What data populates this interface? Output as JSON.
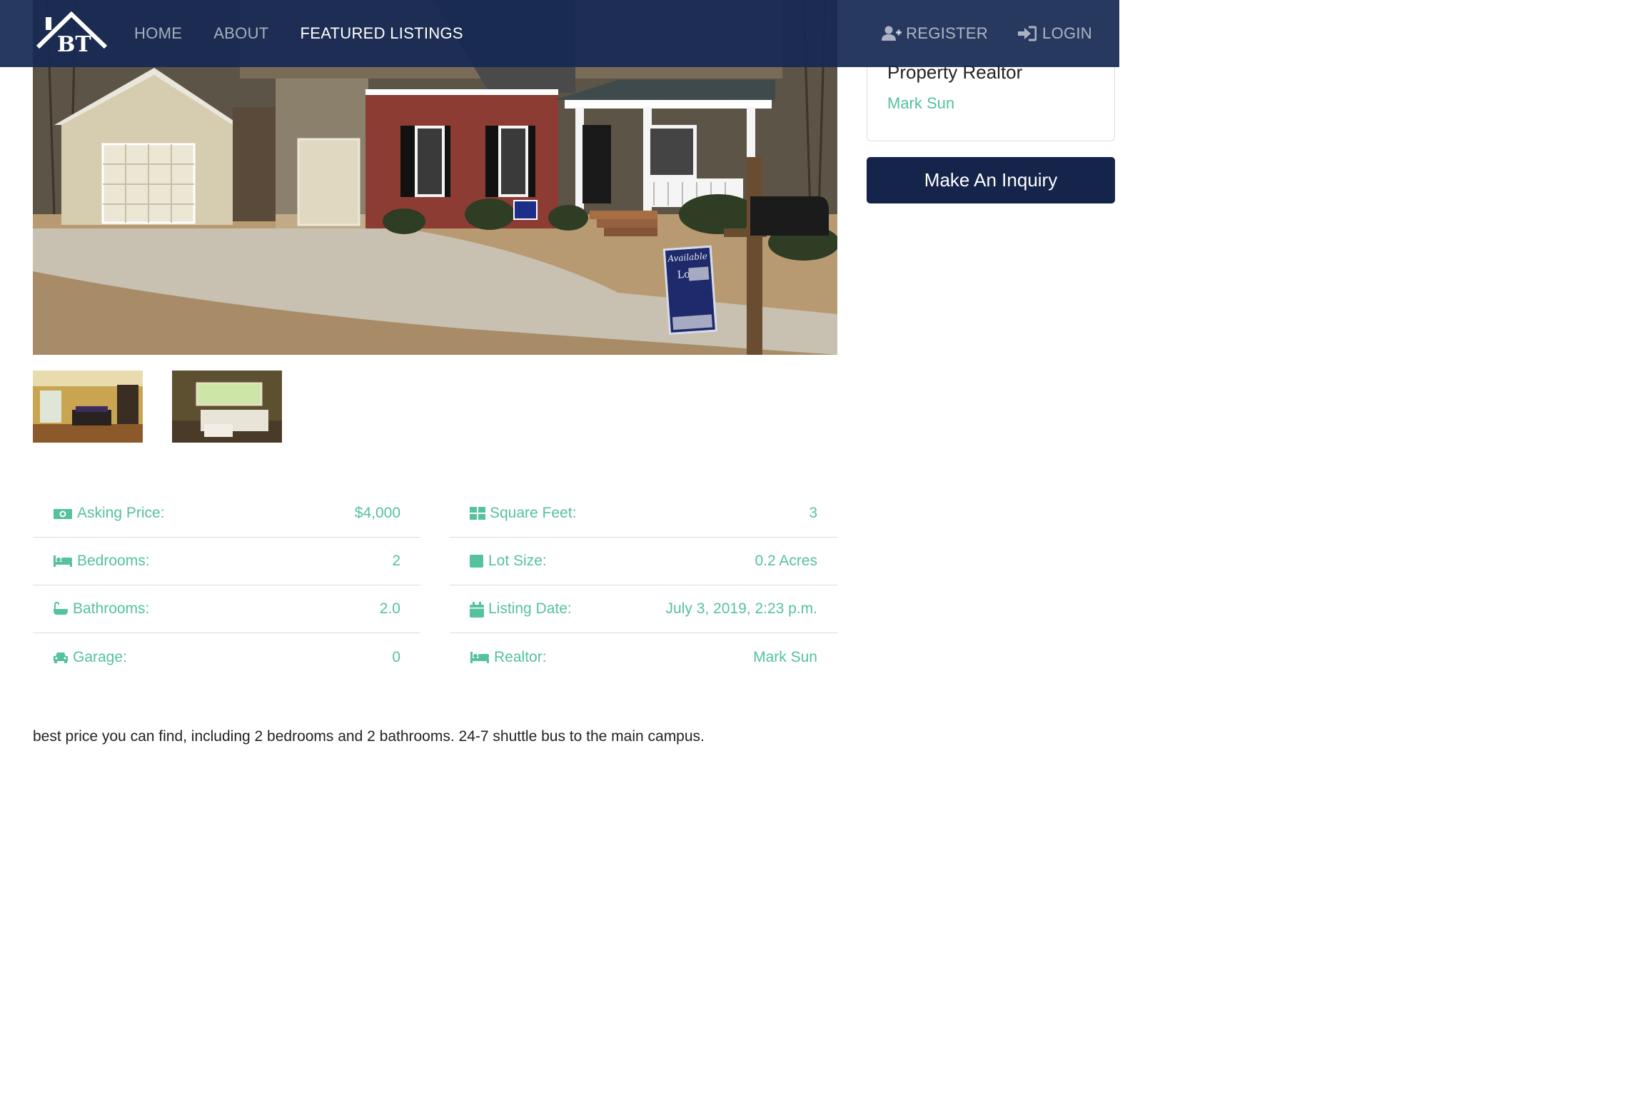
{
  "navbar": {
    "logo_text": "BT",
    "links": [
      {
        "label": "HOME"
      },
      {
        "label": "ABOUT"
      },
      {
        "label": "FEATURED LISTINGS"
      }
    ],
    "register_label": "REGISTER",
    "login_label": "LOGIN",
    "bg_color": "#162852",
    "register_icon": "user-plus-icon",
    "login_icon": "sign-in-icon"
  },
  "realtor_card": {
    "title": "Property Realtor",
    "name": "Mark Sun"
  },
  "inquiry_button": {
    "label": "Make An Inquiry",
    "color": "#15244a"
  },
  "details_left": [
    {
      "label": "Asking Price:",
      "value": "$4,000",
      "icon": "money-icon"
    },
    {
      "label": "Bedrooms:",
      "value": "2",
      "icon": "bed-icon"
    },
    {
      "label": "Bathrooms:",
      "value": "2.0",
      "icon": "bath-icon"
    },
    {
      "label": "Garage:",
      "value": "0",
      "icon": "car-icon"
    }
  ],
  "details_right": [
    {
      "label": "Square Feet:",
      "value": "3",
      "icon": "grid-icon"
    },
    {
      "label": "Lot Size:",
      "value": "0.2 Acres",
      "icon": "square-icon"
    },
    {
      "label": "Listing Date:",
      "value": "July 3, 2019, 2:23 p.m.",
      "icon": "calendar-icon"
    },
    {
      "label": "Realtor:",
      "value": "Mark Sun",
      "icon": "bed-icon"
    }
  ],
  "description": "best price you can find, including 2 bedrooms and 2 bathrooms. 24-7 shuttle bus to the main campus.",
  "colors": {
    "accent": "#54c29c",
    "navbar": "#162852",
    "button": "#15244a"
  },
  "sign": {
    "available": "Available",
    "lot": "Lot#"
  }
}
